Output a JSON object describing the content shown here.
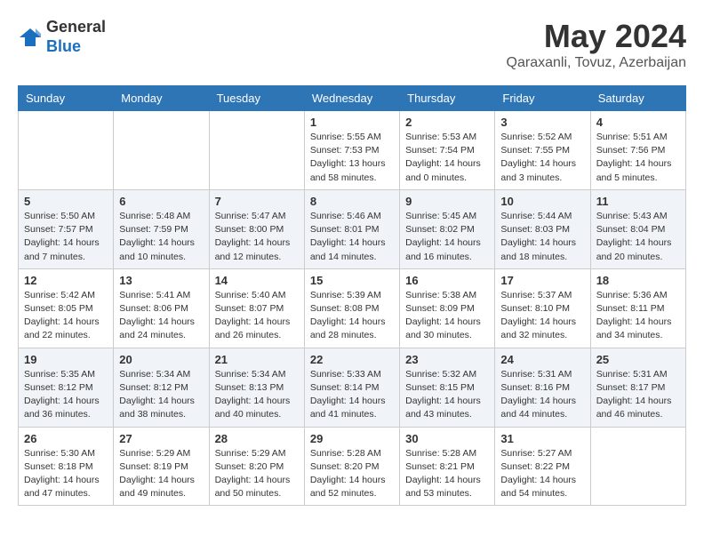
{
  "header": {
    "logo_general": "General",
    "logo_blue": "Blue",
    "month_title": "May 2024",
    "location": "Qaraxanli, Tovuz, Azerbaijan"
  },
  "days_of_week": [
    "Sunday",
    "Monday",
    "Tuesday",
    "Wednesday",
    "Thursday",
    "Friday",
    "Saturday"
  ],
  "weeks": [
    [
      {
        "day": "",
        "info": ""
      },
      {
        "day": "",
        "info": ""
      },
      {
        "day": "",
        "info": ""
      },
      {
        "day": "1",
        "info": "Sunrise: 5:55 AM\nSunset: 7:53 PM\nDaylight: 13 hours\nand 58 minutes."
      },
      {
        "day": "2",
        "info": "Sunrise: 5:53 AM\nSunset: 7:54 PM\nDaylight: 14 hours\nand 0 minutes."
      },
      {
        "day": "3",
        "info": "Sunrise: 5:52 AM\nSunset: 7:55 PM\nDaylight: 14 hours\nand 3 minutes."
      },
      {
        "day": "4",
        "info": "Sunrise: 5:51 AM\nSunset: 7:56 PM\nDaylight: 14 hours\nand 5 minutes."
      }
    ],
    [
      {
        "day": "5",
        "info": "Sunrise: 5:50 AM\nSunset: 7:57 PM\nDaylight: 14 hours\nand 7 minutes."
      },
      {
        "day": "6",
        "info": "Sunrise: 5:48 AM\nSunset: 7:59 PM\nDaylight: 14 hours\nand 10 minutes."
      },
      {
        "day": "7",
        "info": "Sunrise: 5:47 AM\nSunset: 8:00 PM\nDaylight: 14 hours\nand 12 minutes."
      },
      {
        "day": "8",
        "info": "Sunrise: 5:46 AM\nSunset: 8:01 PM\nDaylight: 14 hours\nand 14 minutes."
      },
      {
        "day": "9",
        "info": "Sunrise: 5:45 AM\nSunset: 8:02 PM\nDaylight: 14 hours\nand 16 minutes."
      },
      {
        "day": "10",
        "info": "Sunrise: 5:44 AM\nSunset: 8:03 PM\nDaylight: 14 hours\nand 18 minutes."
      },
      {
        "day": "11",
        "info": "Sunrise: 5:43 AM\nSunset: 8:04 PM\nDaylight: 14 hours\nand 20 minutes."
      }
    ],
    [
      {
        "day": "12",
        "info": "Sunrise: 5:42 AM\nSunset: 8:05 PM\nDaylight: 14 hours\nand 22 minutes."
      },
      {
        "day": "13",
        "info": "Sunrise: 5:41 AM\nSunset: 8:06 PM\nDaylight: 14 hours\nand 24 minutes."
      },
      {
        "day": "14",
        "info": "Sunrise: 5:40 AM\nSunset: 8:07 PM\nDaylight: 14 hours\nand 26 minutes."
      },
      {
        "day": "15",
        "info": "Sunrise: 5:39 AM\nSunset: 8:08 PM\nDaylight: 14 hours\nand 28 minutes."
      },
      {
        "day": "16",
        "info": "Sunrise: 5:38 AM\nSunset: 8:09 PM\nDaylight: 14 hours\nand 30 minutes."
      },
      {
        "day": "17",
        "info": "Sunrise: 5:37 AM\nSunset: 8:10 PM\nDaylight: 14 hours\nand 32 minutes."
      },
      {
        "day": "18",
        "info": "Sunrise: 5:36 AM\nSunset: 8:11 PM\nDaylight: 14 hours\nand 34 minutes."
      }
    ],
    [
      {
        "day": "19",
        "info": "Sunrise: 5:35 AM\nSunset: 8:12 PM\nDaylight: 14 hours\nand 36 minutes."
      },
      {
        "day": "20",
        "info": "Sunrise: 5:34 AM\nSunset: 8:12 PM\nDaylight: 14 hours\nand 38 minutes."
      },
      {
        "day": "21",
        "info": "Sunrise: 5:34 AM\nSunset: 8:13 PM\nDaylight: 14 hours\nand 40 minutes."
      },
      {
        "day": "22",
        "info": "Sunrise: 5:33 AM\nSunset: 8:14 PM\nDaylight: 14 hours\nand 41 minutes."
      },
      {
        "day": "23",
        "info": "Sunrise: 5:32 AM\nSunset: 8:15 PM\nDaylight: 14 hours\nand 43 minutes."
      },
      {
        "day": "24",
        "info": "Sunrise: 5:31 AM\nSunset: 8:16 PM\nDaylight: 14 hours\nand 44 minutes."
      },
      {
        "day": "25",
        "info": "Sunrise: 5:31 AM\nSunset: 8:17 PM\nDaylight: 14 hours\nand 46 minutes."
      }
    ],
    [
      {
        "day": "26",
        "info": "Sunrise: 5:30 AM\nSunset: 8:18 PM\nDaylight: 14 hours\nand 47 minutes."
      },
      {
        "day": "27",
        "info": "Sunrise: 5:29 AM\nSunset: 8:19 PM\nDaylight: 14 hours\nand 49 minutes."
      },
      {
        "day": "28",
        "info": "Sunrise: 5:29 AM\nSunset: 8:20 PM\nDaylight: 14 hours\nand 50 minutes."
      },
      {
        "day": "29",
        "info": "Sunrise: 5:28 AM\nSunset: 8:20 PM\nDaylight: 14 hours\nand 52 minutes."
      },
      {
        "day": "30",
        "info": "Sunrise: 5:28 AM\nSunset: 8:21 PM\nDaylight: 14 hours\nand 53 minutes."
      },
      {
        "day": "31",
        "info": "Sunrise: 5:27 AM\nSunset: 8:22 PM\nDaylight: 14 hours\nand 54 minutes."
      },
      {
        "day": "",
        "info": ""
      }
    ]
  ]
}
